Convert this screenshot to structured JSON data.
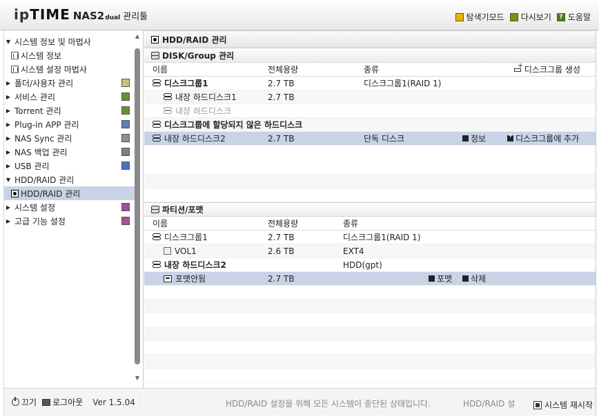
{
  "header": {
    "logo_ip": "ip",
    "logo_time": "TIME",
    "logo_model": "NAS2",
    "logo_dual": "dual",
    "logo_manager": "관리툴",
    "links": {
      "explorer": "탐색기모드",
      "refresh": "다시보기",
      "help": "도움말"
    }
  },
  "sidebar": {
    "items": [
      {
        "label": "시스템 정보 및 마법사"
      },
      {
        "label": "시스템 정보"
      },
      {
        "label": "시스템 설정 마법사"
      },
      {
        "label": "폴더/사용자 관리"
      },
      {
        "label": "서비스 관리"
      },
      {
        "label": "Torrent 관리"
      },
      {
        "label": "Plug-in APP 관리"
      },
      {
        "label": "NAS Sync 관리"
      },
      {
        "label": "NAS 백업 관리"
      },
      {
        "label": "USB 관리"
      },
      {
        "label": "HDD/RAID 관리"
      },
      {
        "label": "HDD/RAID 관리"
      },
      {
        "label": "시스템 설정"
      },
      {
        "label": "고급 기능 설정"
      }
    ],
    "footer": {
      "power": "끄기",
      "logout": "로그아웃",
      "version": "Ver 1.5.04"
    }
  },
  "main": {
    "title": "HDD/RAID 관리",
    "disk_group": {
      "title": "DISK/Group 관리",
      "headers": {
        "name": "이름",
        "capacity": "전체용량",
        "type": "종류"
      },
      "create_label": "디스크그룹 생성",
      "group1": {
        "name": "디스크그룹1",
        "capacity": "2.7 TB",
        "type": "디스크그룹1(RAID 1)"
      },
      "disk1": {
        "name": "내장 하드디스크1",
        "capacity": "2.7 TB"
      },
      "disk_empty": {
        "name": "내장 하드디스크"
      },
      "unassigned_title": "디스크그룹에 할당되지 않은 하드디스크",
      "disk2": {
        "name": "내장 하드디스크2",
        "capacity": "2.7 TB",
        "type": "단독 디스크",
        "info": "정보",
        "add": "디스크그룹에 추가"
      }
    },
    "partition": {
      "title": "파티션/포맷",
      "headers": {
        "name": "이름",
        "capacity": "전체용량",
        "type": "종류"
      },
      "group1": {
        "name": "디스크그룹1",
        "capacity": "2.7 TB",
        "type": "디스크그룹1(RAID 1)"
      },
      "vol1": {
        "name": "VOL1",
        "capacity": "2.6 TB",
        "type": "EXT4"
      },
      "disk2": {
        "name": "내장 하드디스크2",
        "type": "HDD(gpt)"
      },
      "unformatted": {
        "name": "포맷안됨",
        "capacity": "2.7 TB",
        "format": "포맷",
        "delete": "삭제"
      }
    },
    "status": {
      "message": "HDD/RAID 설정을 위해 모든 시스템이 중단된 상태입니다.",
      "message2": "HDD/RAID 설",
      "restart": "시스템 재시작"
    }
  }
}
